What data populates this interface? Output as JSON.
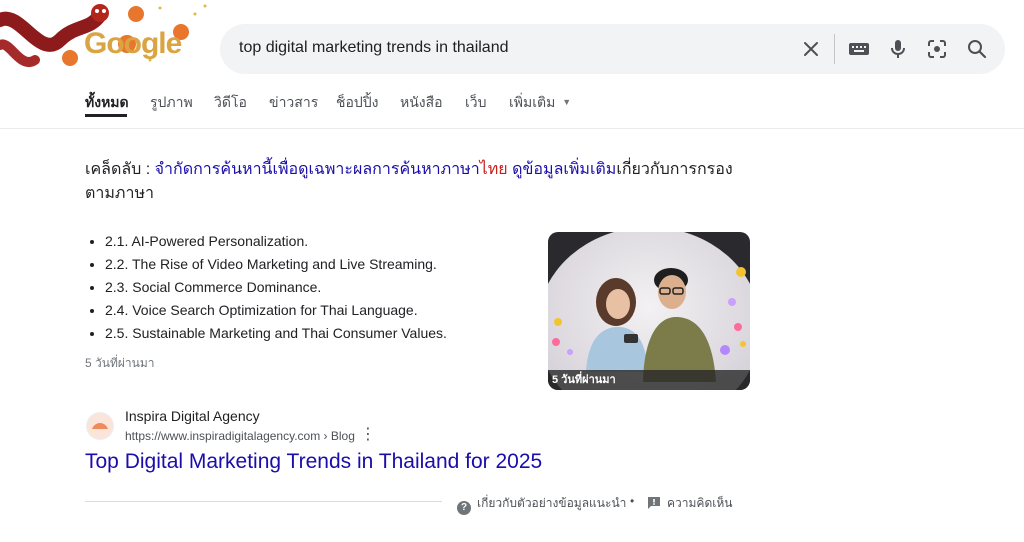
{
  "search": {
    "query": "top digital marketing trends in thailand"
  },
  "logo": {
    "text": "Google"
  },
  "tabs": [
    {
      "label": "ทั้งหมด",
      "active": true
    },
    {
      "label": "รูปภาพ"
    },
    {
      "label": "วิดีโอ"
    },
    {
      "label": "ข่าวสาร"
    },
    {
      "label": "ช็อปปิ้ง"
    },
    {
      "label": "หนังสือ"
    },
    {
      "label": "เว็บ"
    },
    {
      "label": "เพิ่มเติม"
    }
  ],
  "tip": {
    "prefix": "เคล็ดลับ : ",
    "link1": "จำกัดการค้นหานี้เพื่อดูเฉพาะผลการค้นหาภาษา",
    "language": "ไทย",
    "link2": "ดูข้อมูลเพิ่มเติม",
    "suffix": "เกี่ยวกับการกรองตามภาษา"
  },
  "snippet": {
    "items": [
      "2.1. AI-Powered Personalization.",
      "2.2. The Rise of Video Marketing and Live Streaming.",
      "2.3. Social Commerce Dominance.",
      "2.4. Voice Search Optimization for Thai Language.",
      "2.5. Sustainable Marketing and Thai Consumer Values."
    ],
    "date": "5 วันที่ผ่านมา",
    "thumbnail_caption": "5 วันที่ผ่านมา"
  },
  "result": {
    "site_name": "Inspira Digital Agency",
    "url": "https://www.inspiradigitalagency.com › Blog",
    "title": "Top Digital Marketing Trends in Thailand for 2025"
  },
  "footer": {
    "about_snippet": "เกี่ยวกับตัวอย่างข้อมูลแนะนำ",
    "separator": "•",
    "feedback": "ความคิดเห็น"
  },
  "colors": {
    "link": "#1a0dab",
    "language_highlight": "#c5221f",
    "search_bg": "#f1f3f4"
  }
}
